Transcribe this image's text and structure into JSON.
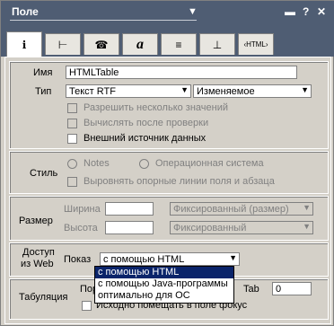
{
  "title": "Поле",
  "title_dropdown_glyph": "▼",
  "titlebar_icons": [
    "▬",
    "?",
    "✕"
  ],
  "tabs": [
    {
      "label": "",
      "icon": "info-icon",
      "glyph": "ℹ"
    },
    {
      "label": "",
      "icon": "field-type-icon",
      "glyph": "⊢"
    },
    {
      "label": "",
      "icon": "hat-icon",
      "glyph": "☎"
    },
    {
      "label": "",
      "icon": "font-icon",
      "glyph": "a"
    },
    {
      "label": "",
      "icon": "paragraph-icon",
      "glyph": "≡"
    },
    {
      "label": "",
      "icon": "hide-when-icon",
      "glyph": "⊥"
    },
    {
      "label": "",
      "icon": "html-icon",
      "glyph": "‹HTML›"
    }
  ],
  "basics": {
    "name_label": "Имя",
    "name_value": "HTMLTable",
    "type_label": "Тип",
    "type_value": "Текст RTF",
    "mode_value": "Изменяемое",
    "allow_multi_label": "Разрешить несколько значений",
    "compute_after_label": "Вычислять после проверки",
    "external_source_label": "Внешний источник данных"
  },
  "style": {
    "label": "Стиль",
    "notes_label": "Notes",
    "os_label": "Операционная система",
    "align_label": "Выровнять опорные линии поля и абзаца"
  },
  "size": {
    "label": "Размер",
    "width_label": "Ширина",
    "height_label": "Высота",
    "width_mode": "Фиксированный (размер)",
    "height_mode": "Фиксированный"
  },
  "web": {
    "label_line1": "Доступ",
    "label_line2": "из Web",
    "show_label": "Показ",
    "show_value": "с помощью HTML",
    "options": [
      "с помощью HTML",
      "с помощью Java-программы",
      "оптимально для ОС"
    ]
  },
  "tab_order": {
    "label": "Табуляция",
    "partial_text": "Пор",
    "tab_label": "Tab",
    "tab_value": "0",
    "focus_label": "Исходно помещать в поле фокус"
  }
}
